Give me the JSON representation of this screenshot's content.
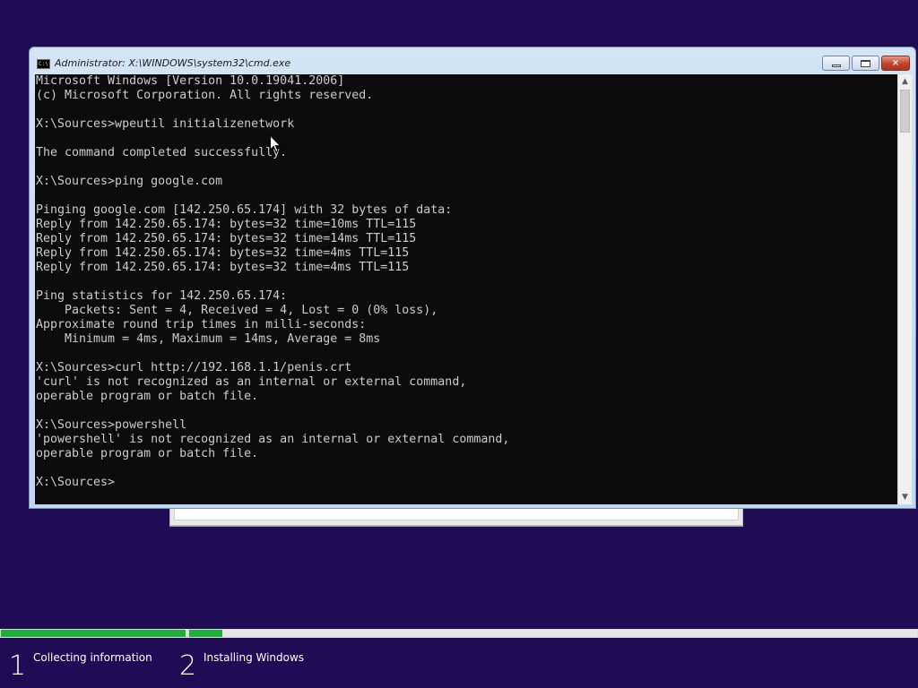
{
  "window": {
    "title": "Administrator: X:\\WINDOWS\\system32\\cmd.exe",
    "icon": "C:\\",
    "controls": {
      "minimize": "minimize-icon",
      "maximize": "maximize-icon",
      "close": "×"
    }
  },
  "console": {
    "lines": "Microsoft Windows [Version 10.0.19041.2006]\n(c) Microsoft Corporation. All rights reserved.\n\nX:\\Sources>wpeutil initializenetwork\n\nThe command completed successfully.\n\nX:\\Sources>ping google.com\n\nPinging google.com [142.250.65.174] with 32 bytes of data:\nReply from 142.250.65.174: bytes=32 time=10ms TTL=115\nReply from 142.250.65.174: bytes=32 time=14ms TTL=115\nReply from 142.250.65.174: bytes=32 time=4ms TTL=115\nReply from 142.250.65.174: bytes=32 time=4ms TTL=115\n\nPing statistics for 142.250.65.174:\n    Packets: Sent = 4, Received = 4, Lost = 0 (0% loss),\nApproximate round trip times in milli-seconds:\n    Minimum = 4ms, Maximum = 14ms, Average = 8ms\n\nX:\\Sources>curl http://192.168.1.1/penis.crt\n'curl' is not recognized as an internal or external command,\noperable program or batch file.\n\nX:\\Sources>powershell\n'powershell' is not recognized as an internal or external command,\noperable program or batch file.\n\nX:\\Sources>"
  },
  "scrollbar": {
    "up": "▲",
    "down": "▼"
  },
  "setup": {
    "progress": {
      "step1_fraction": 1.0,
      "step2_fraction": 0.046
    },
    "steps": [
      {
        "number": "1",
        "label": "Collecting information"
      },
      {
        "number": "2",
        "label": "Installing Windows"
      }
    ]
  },
  "colors": {
    "desktop": "#200b55",
    "progress_fill": "#1fae3a",
    "console_bg": "#0c0c0c",
    "console_fg": "#cccccc"
  }
}
